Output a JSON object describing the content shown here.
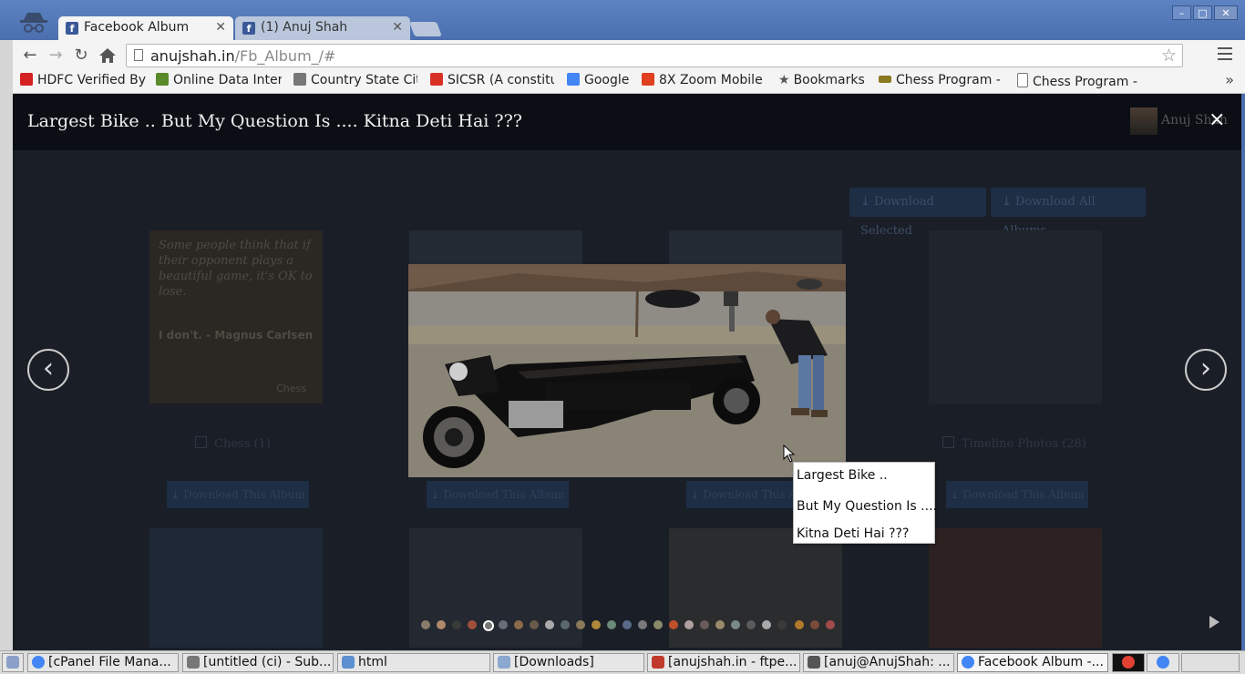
{
  "browser": {
    "tabs": [
      {
        "label": "Facebook Album",
        "active": true
      },
      {
        "label": "(1) Anuj Shah",
        "active": false
      }
    ],
    "url_host": "anujshah.in",
    "url_path": "/Fb_Album_/#",
    "bookmarks": [
      {
        "label": "HDFC Verified By",
        "fade": "",
        "icon": "hdfc-icon",
        "color": "#d42020"
      },
      {
        "label": "Online Data Inter",
        "fade": "",
        "icon": "leaf-icon",
        "color": "#5a8a2a"
      },
      {
        "label": "Country State Cit",
        "fade": "",
        "icon": "swirl-icon",
        "color": "#444444"
      },
      {
        "label": "SICSR (A constitu",
        "fade": "",
        "icon": "gmail-icon",
        "color": "#d93025"
      },
      {
        "label": "Google",
        "fade": "",
        "icon": "google-icon",
        "color": "#4285f4"
      },
      {
        "label": "8X Zoom Mobile",
        "fade": "",
        "icon": "app-icon",
        "color": "#e04020"
      },
      {
        "label": "Bookmarks",
        "fade": "",
        "icon": "star-icon",
        "color": "#555555"
      },
      {
        "label": "Chess Program -",
        "fade": "",
        "icon": "chess-icon",
        "color": "#8a7a20"
      },
      {
        "label": "Chess Program -",
        "fade": "",
        "icon": "page-icon",
        "color": "#777777"
      }
    ]
  },
  "lightbox": {
    "title": "Largest Bike .. But My Question Is .... Kitna Deti Hai ???",
    "user": "Anuj Shah",
    "close": "×",
    "prev": "‹",
    "next": "›"
  },
  "gallery": {
    "download_selected": "Download Selected",
    "download_all": "Download All Albums",
    "album_button": "Download This Album",
    "albums": [
      {
        "label": "Chess (1)"
      },
      {
        "label": ""
      },
      {
        "label": ""
      },
      {
        "label": "Timeline Photos (28)"
      }
    ],
    "chess_quote": "Some people think that if their opponent plays a beautiful game, it's OK to lose.",
    "chess_quote2": "I don't. - Magnus Carlsen",
    "chess_mark": "Chess"
  },
  "context_menu": {
    "items": [
      "Largest Bike ..",
      "But My Question Is ....",
      "Kitna Deti Hai ???"
    ]
  },
  "thumbnail_strip": {
    "count": 27,
    "active_index": 4
  },
  "taskbar": {
    "items": [
      {
        "label": "[cPanel File Mana...",
        "color": "#4285f4",
        "active": false
      },
      {
        "label": "[untitled (ci) - Sub...",
        "color": "#777777",
        "active": false
      },
      {
        "label": "html",
        "color": "#5b8fd0",
        "active": false
      },
      {
        "label": "[Downloads]",
        "color": "#8aa8d0",
        "active": false
      },
      {
        "label": "[anujshah.in - ftpe...",
        "color": "#c0392b",
        "active": false
      },
      {
        "label": "[anuj@AnujShah: ...",
        "color": "#555555",
        "active": false
      },
      {
        "label": "Facebook Album -...",
        "color": "#4285f4",
        "active": true
      }
    ]
  }
}
